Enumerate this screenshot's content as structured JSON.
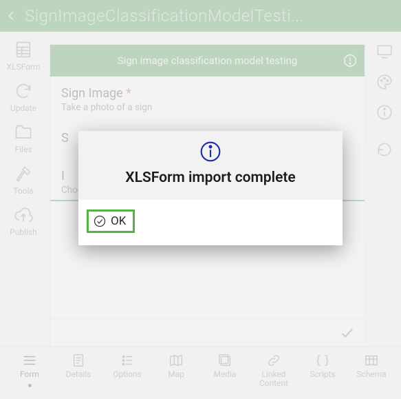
{
  "header": {
    "title": "SignImageClassificationModelTesti..."
  },
  "leftRail": {
    "xlsform": "XLSForm",
    "update": "Update",
    "files": "Files",
    "tools": "Tools",
    "publish": "Publish"
  },
  "form": {
    "headerTitle": "Sign image classification model testing",
    "q1_title": "Sign Image",
    "q1_hint": "Take a photo of a sign",
    "q2_title_frag": "S",
    "q3_title_frag": "I",
    "q3_hint": "Choose yes for the type is what you expect, otherwise choose no"
  },
  "bottom": {
    "form": "Form",
    "details": "Details",
    "options": "Options",
    "map": "Map",
    "media": "Media",
    "linked": "Linked\nContent",
    "scripts": "Scripts",
    "schema": "Schema"
  },
  "dialog": {
    "title": "XLSForm import complete",
    "ok": "OK"
  }
}
